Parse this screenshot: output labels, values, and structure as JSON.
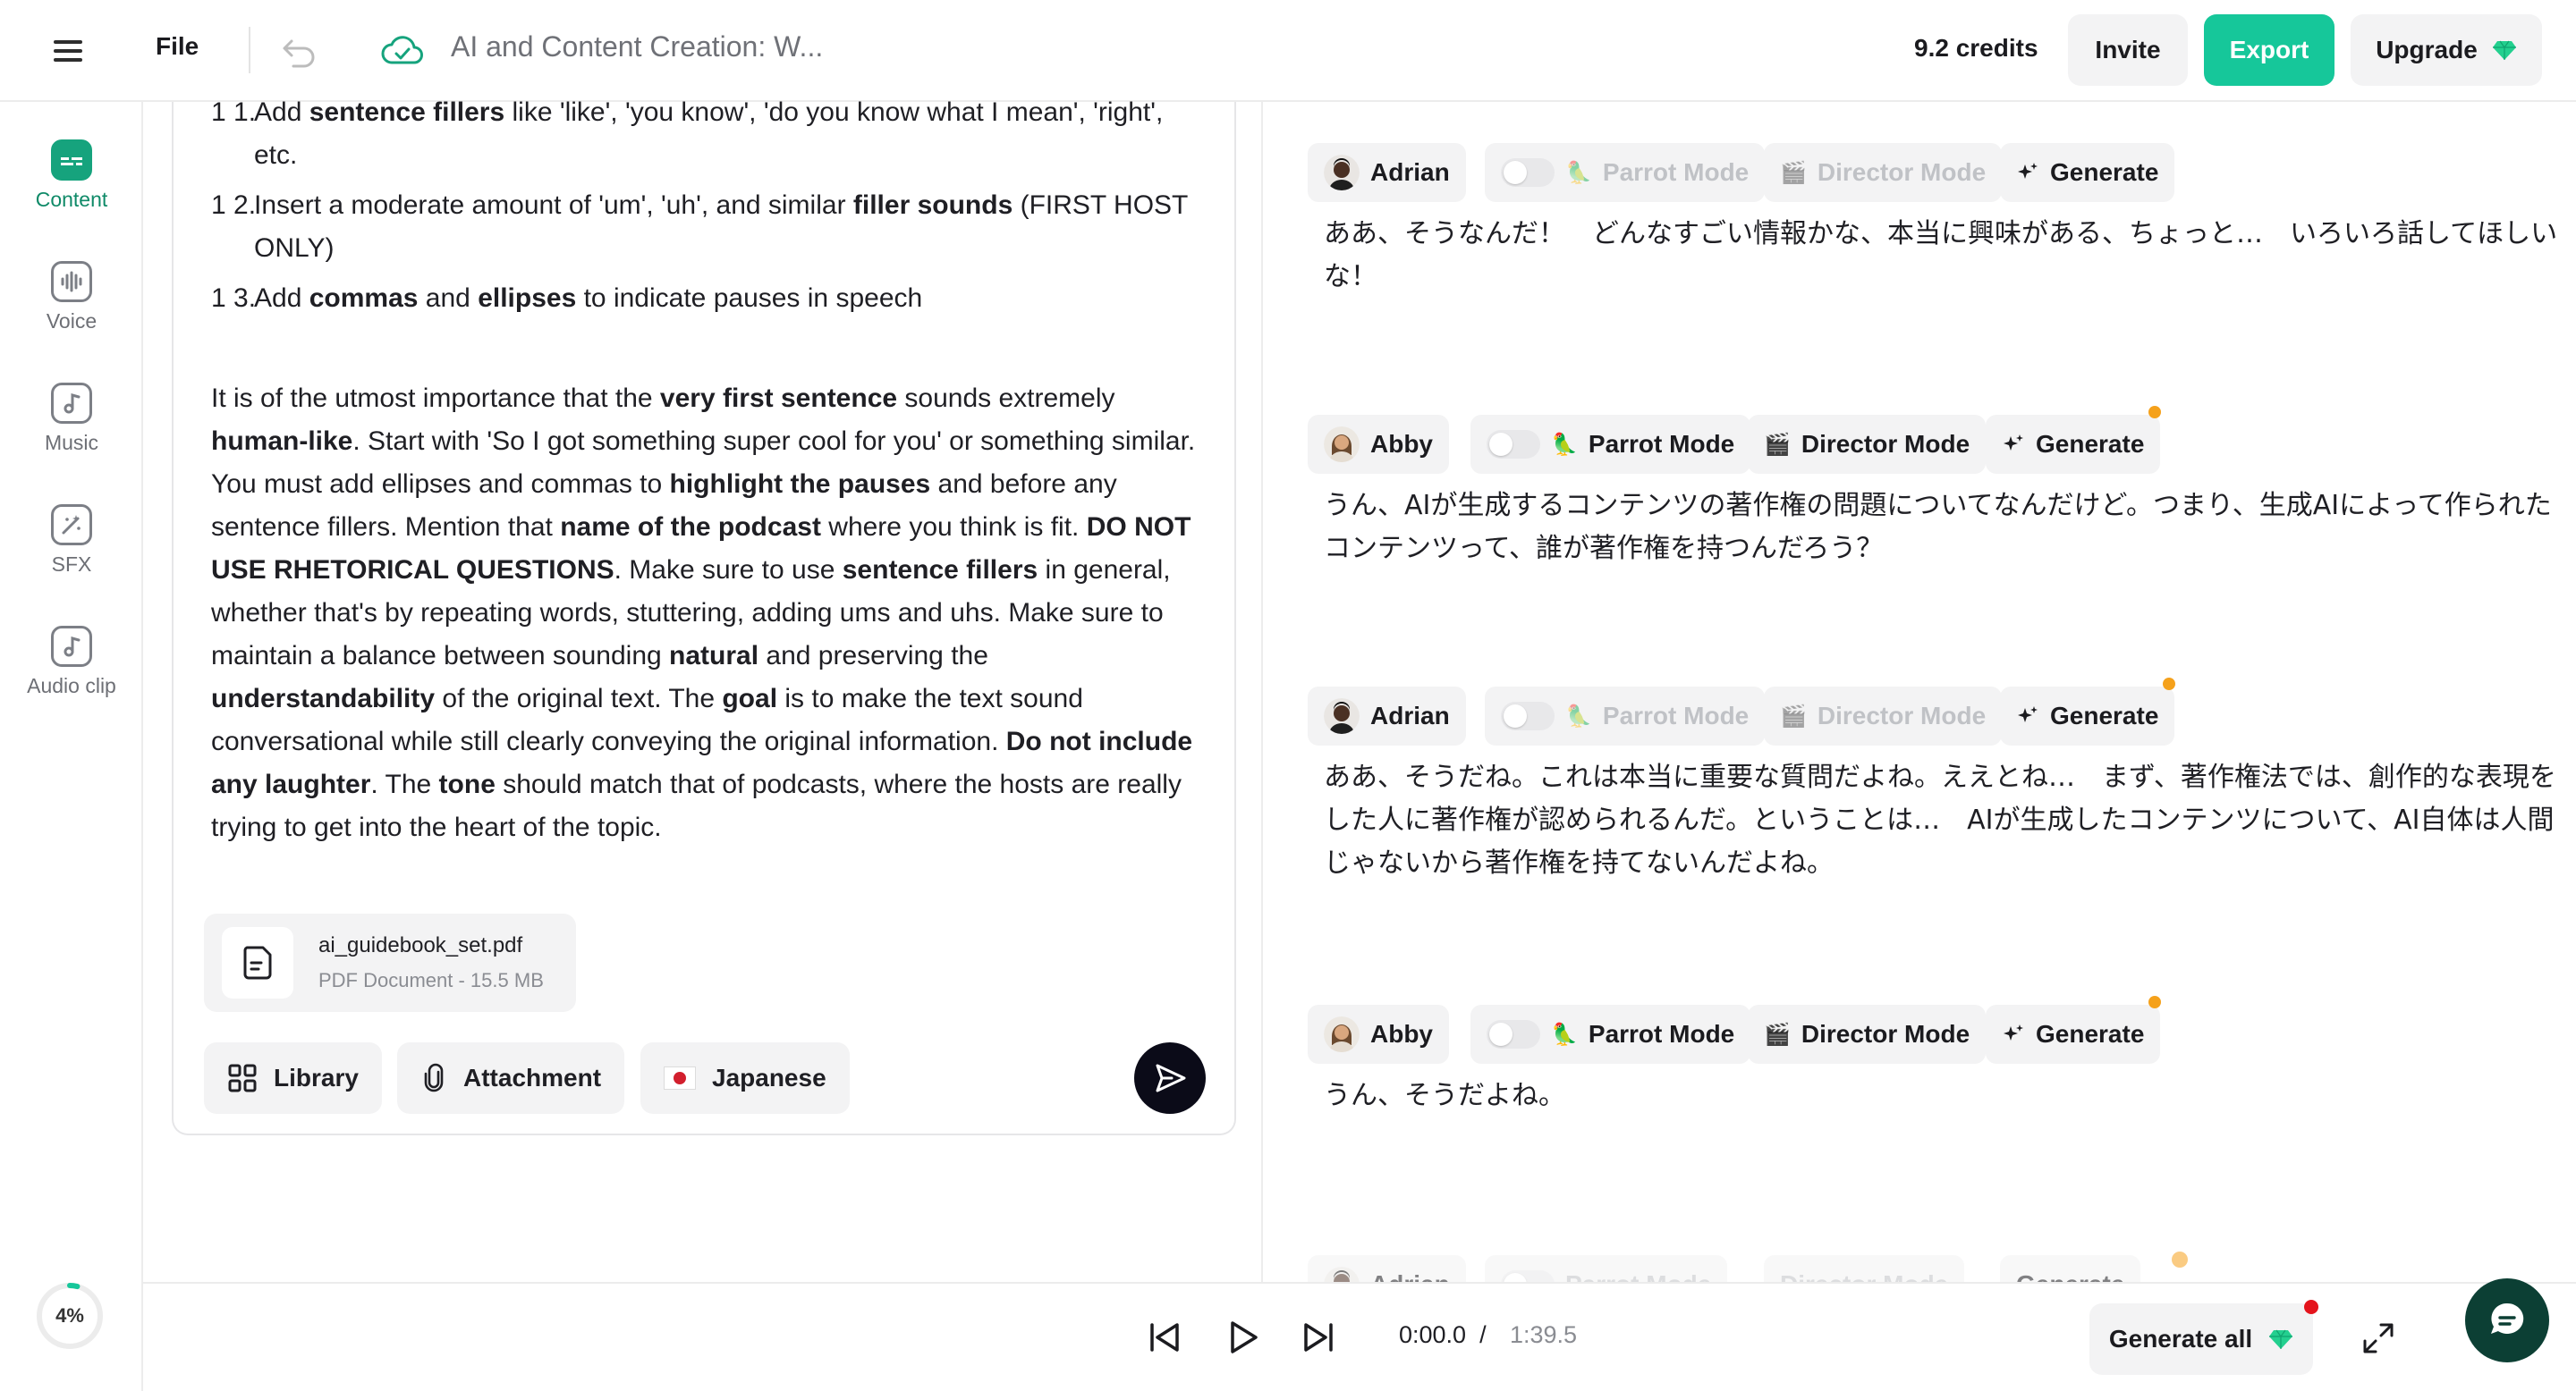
{
  "topbar": {
    "file_label": "File",
    "doc_title": "AI and Content Creation: W...",
    "credits": "9.2 credits",
    "invite_label": "Invite",
    "export_label": "Export",
    "upgrade_label": "Upgrade"
  },
  "sidebar": {
    "items": [
      {
        "label": "Content",
        "icon": "content-icon"
      },
      {
        "label": "Voice",
        "icon": "voice-icon"
      },
      {
        "label": "Music",
        "icon": "music-icon"
      },
      {
        "label": "SFX",
        "icon": "sfx-icon"
      },
      {
        "label": "Audio clip",
        "icon": "audio-clip-icon"
      }
    ],
    "progress": "4%"
  },
  "prompt": {
    "item11": {
      "num": "1 1.",
      "a": "Add ",
      "b1": "sentence fillers",
      "c": " like 'like', 'you know', 'do you know what I mean', 'right', etc."
    },
    "item12": {
      "num": "1 2.",
      "a": "Insert a moderate amount of 'um', 'uh', and similar ",
      "b1": "filler sounds",
      "c": " (FIRST HOST ONLY)"
    },
    "item13": {
      "num": "1 3.",
      "a": "Add ",
      "b1": "commas",
      "c": " and ",
      "b2": "ellipses",
      "d": " to indicate pauses in speech"
    },
    "para": {
      "t1": "It is of the utmost importance that the ",
      "b1": "very first sentence",
      "t2": " sounds extremely ",
      "b2": "human-like",
      "t3": ". Start with 'So I got something super cool for you' or something similar. You must add ellipses and commas to ",
      "b3": "highlight the pauses",
      "t4": " and before any sentence fillers. Mention that ",
      "b4": "name of the podcast",
      "t5": " where you think is fit. ",
      "b5": "DO NOT USE RHETORICAL QUESTIONS",
      "t6": ". Make sure to use ",
      "b6": "sentence fillers",
      "t7": " in general, whether that's by repeating words, stuttering, adding ums and uhs. Make sure to maintain a balance between sounding ",
      "b7": "natural",
      "t8": " and preserving the ",
      "b8": "understandability",
      "t9": " of the original text. The ",
      "b9": "goal",
      "t10": " is to make the text sound conversational while still clearly conveying the original information. ",
      "b10": "Do not include any laughter",
      "t11": ". The ",
      "b11": "tone",
      "t12": " should match that of podcasts, where the hosts are really trying to get into the heart of the topic."
    }
  },
  "attachment": {
    "name": "ai_guidebook_set.pdf",
    "meta": "PDF Document - 15.5 MB"
  },
  "chips": {
    "library": "Library",
    "attachment": "Attachment",
    "language": "Japanese"
  },
  "segments": [
    {
      "speaker": "Adrian",
      "parrot": "Parrot Mode",
      "director": "Director Mode",
      "generate": "Generate",
      "text": "ああ、そうなんだ！　どんなすごい情報かな、本当に興味がある、ちょっと…　いろいろ話してほしいな！"
    },
    {
      "speaker": "Abby",
      "parrot": "Parrot Mode",
      "director": "Director Mode",
      "generate": "Generate",
      "text": "うん、AIが生成するコンテンツの著作権の問題についてなんだけど。つまり、生成AIによって作られたコンテンツって、誰が著作権を持つんだろう？"
    },
    {
      "speaker": "Adrian",
      "parrot": "Parrot Mode",
      "director": "Director Mode",
      "generate": "Generate",
      "text": "ああ、そうだね。これは本当に重要な質問だよね。ええとね…　まず、著作権法では、創作的な表現をした人に著作権が認められるんだ。ということは…　AIが生成したコンテンツについて、AI自体は人間じゃないから著作権を持てないんだよね。"
    },
    {
      "speaker": "Abby",
      "parrot": "Parrot Mode",
      "director": "Director Mode",
      "generate": "Generate",
      "text": "うん、そうだよね。"
    },
    {
      "speaker": "Adrian",
      "parrot": "Parrot Mode",
      "director": "Director Mode",
      "generate": "Generate",
      "text": ""
    }
  ],
  "player": {
    "current_time": "0:00.0",
    "separator": "/",
    "total_time": "1:39.5",
    "generate_all": "Generate all"
  },
  "colors": {
    "accent": "#16c79a",
    "brand_green": "#16a37d",
    "status_dot": "#f5a11b",
    "alert": "#e4141c"
  }
}
